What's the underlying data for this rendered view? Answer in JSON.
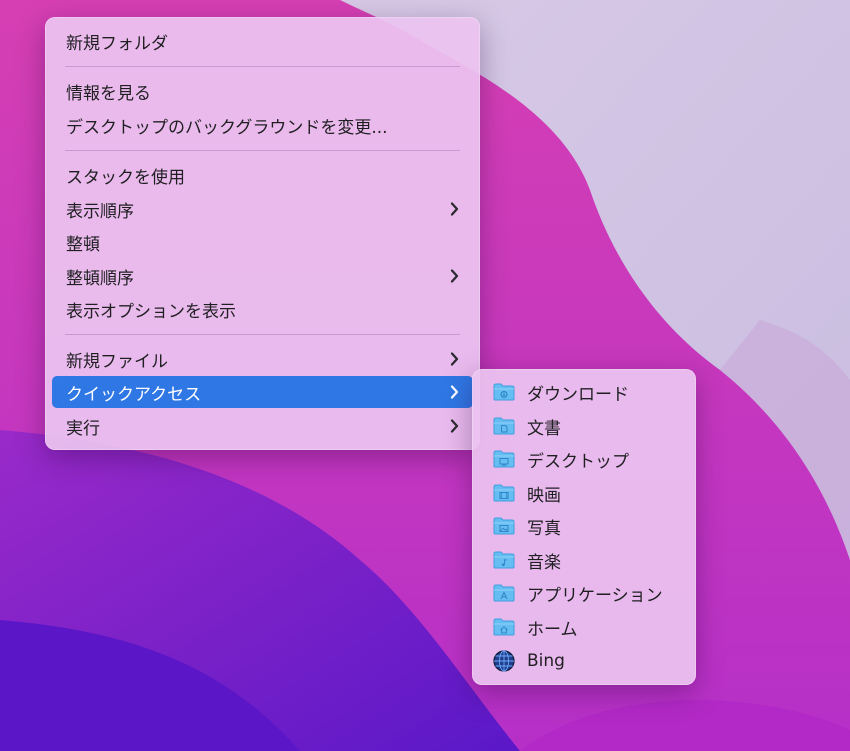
{
  "colors": {
    "highlight": "#2f77e4",
    "menu_bg": "#ecc4f0",
    "folder": "#5fb8f0"
  },
  "main_menu": {
    "new_folder": "新規フォルダ",
    "get_info": "情報を見る",
    "change_background": "デスクトップのバックグラウンドを変更...",
    "use_stacks": "スタックを使用",
    "sort_by": "表示順序",
    "clean_up": "整頓",
    "clean_up_by": "整頓順序",
    "show_view_options": "表示オプションを表示",
    "new_file": "新規ファイル",
    "quick_access": "クイックアクセス",
    "run": "実行"
  },
  "quick_access_submenu": {
    "items": [
      {
        "label": "ダウンロード",
        "icon": "downloads-folder-icon"
      },
      {
        "label": "文書",
        "icon": "documents-folder-icon"
      },
      {
        "label": "デスクトップ",
        "icon": "desktop-folder-icon"
      },
      {
        "label": "映画",
        "icon": "movies-folder-icon"
      },
      {
        "label": "写真",
        "icon": "pictures-folder-icon"
      },
      {
        "label": "音楽",
        "icon": "music-folder-icon"
      },
      {
        "label": "アプリケーション",
        "icon": "applications-folder-icon"
      },
      {
        "label": "ホーム",
        "icon": "home-folder-icon"
      },
      {
        "label": "Bing",
        "icon": "globe-icon"
      }
    ]
  }
}
